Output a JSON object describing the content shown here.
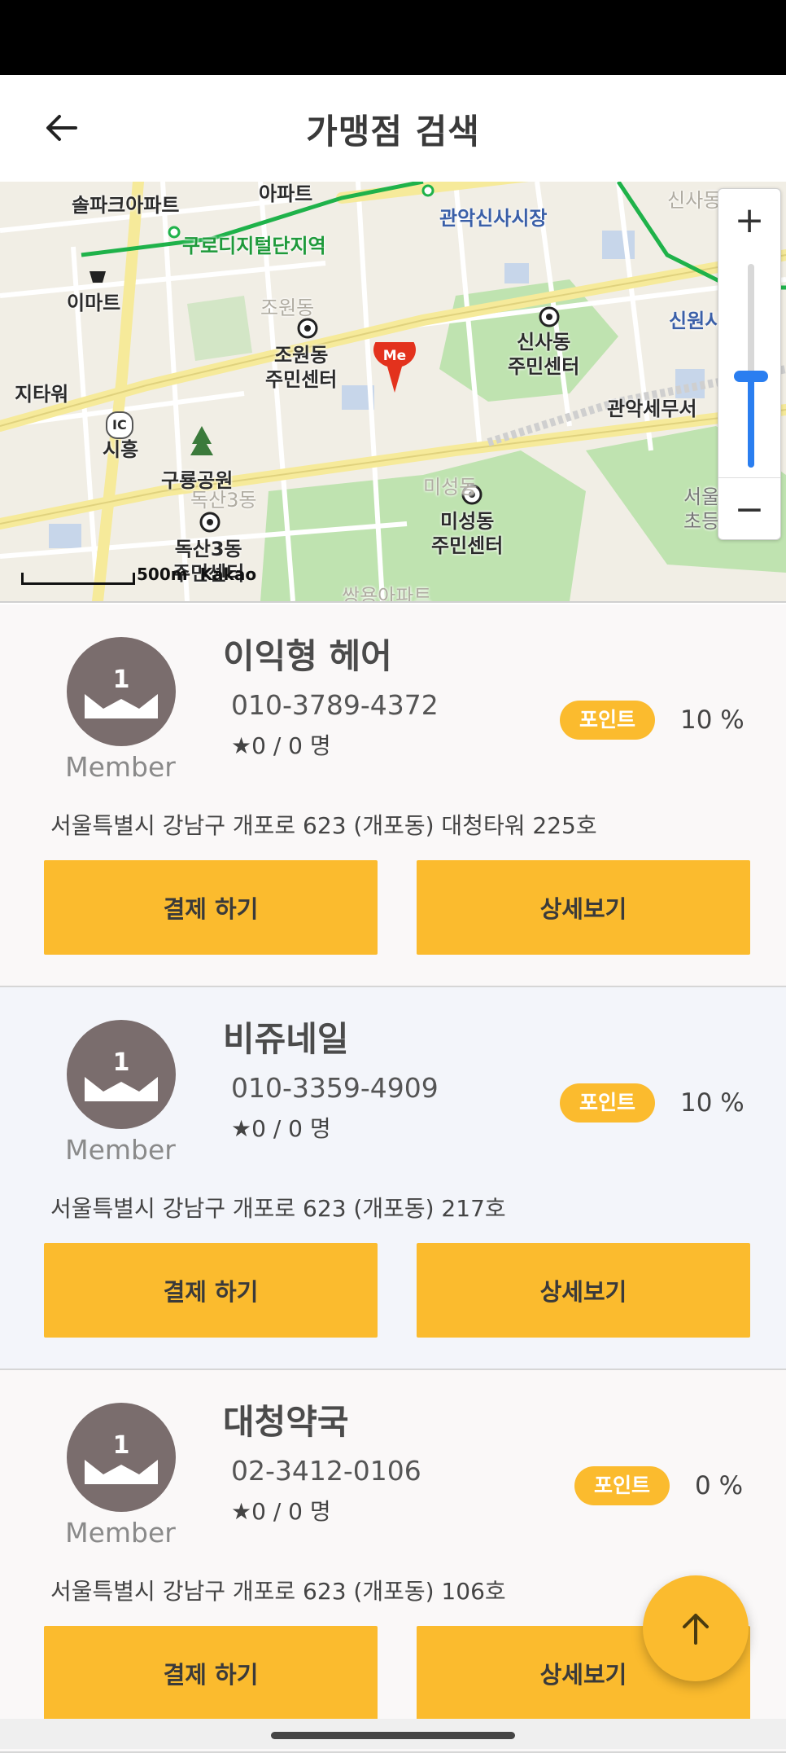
{
  "header": {
    "title": "가맹점 검색",
    "back_icon": "arrow-left-icon"
  },
  "map": {
    "labels": {
      "apartment1": "솔파크아파트",
      "apartment2": "아파트",
      "station": "구로디지털단지역",
      "market": "관악신사시장",
      "sinsa_top": "신사동",
      "emart": "이마트",
      "jowon_faded": "조원동",
      "jowon_center": "조원동\n주민센터",
      "sinsa_center": "신사동\n주민센터",
      "sinwon": "신원시장",
      "gwanak_tax": "관악세무서",
      "jitawon": "지타워",
      "siheung": "시흥",
      "ic": "IC",
      "guryong": "구룡공원",
      "doksan3_faded": "독산3동",
      "misung_faded": "미성동",
      "misung_center": "미성동\n주민센터",
      "doksan3_center": "독산3동\n주민센터",
      "seoul_school": "서울\n초등",
      "ssangyong": "쌍용아파트",
      "scale": "500m",
      "brand": "Kakao",
      "me": "Me"
    },
    "zoom_in": "+",
    "zoom_out": "−",
    "zoom_level_fraction": 0.45
  },
  "stores": [
    {
      "name": "이익형 헤어",
      "phone": "010-3789-4372",
      "rating": "★0 / 0 명",
      "point_label": "포인트",
      "point_value": "10 %",
      "address": "서울특별시 강남구 개포로 623 (개포동) 대청타워 225호",
      "member": "Member",
      "badge_number": "1",
      "pay_label": "결제 하기",
      "detail_label": "상세보기"
    },
    {
      "name": "비쥬네일",
      "phone": "010-3359-4909",
      "rating": "★0 / 0 명",
      "point_label": "포인트",
      "point_value": "10 %",
      "address": "서울특별시 강남구 개포로 623 (개포동) 217호",
      "member": "Member",
      "badge_number": "1",
      "pay_label": "결제 하기",
      "detail_label": "상세보기"
    },
    {
      "name": "대청약국",
      "phone": "02-3412-0106",
      "rating": "★0 / 0 명",
      "point_label": "포인트",
      "point_value": "0 %",
      "address": "서울특별시 강남구 개포로 623 (개포동) 106호",
      "member": "Member",
      "badge_number": "1",
      "pay_label": "결제 하기",
      "detail_label": "상세보기"
    }
  ],
  "fab_icon": "arrow-up-icon",
  "colors": {
    "accent": "#fbbb2e",
    "badge": "#7a6d6d",
    "zoom": "#2a7ef0"
  }
}
